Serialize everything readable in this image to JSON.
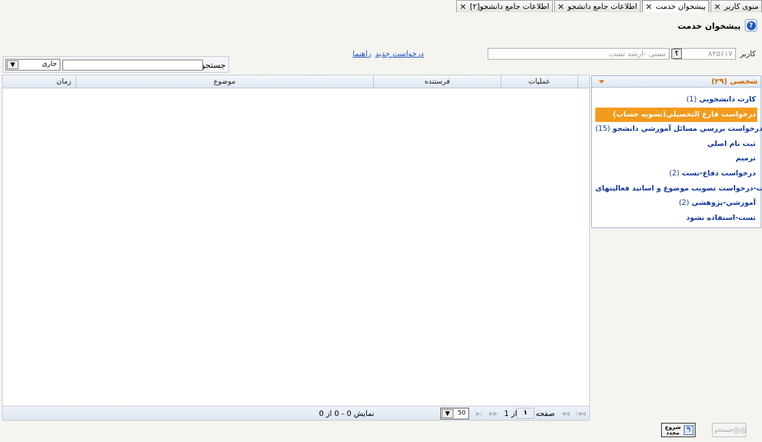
{
  "tabs": [
    {
      "label": "منوی کاربر",
      "active": false
    },
    {
      "label": "پیشخوان خدمت",
      "active": true
    },
    {
      "label": "اطلاعات جامع دانشجو",
      "active": false
    },
    {
      "label": "اطلاعات جامع دانشجو[۲]",
      "active": false
    }
  ],
  "header": {
    "title": "پیشخوان خدمت",
    "help_icon": "?"
  },
  "user": {
    "label": "کاربر",
    "code": "۸۴۵۶۱۷",
    "lookup": "؟",
    "name": "تستی -ارشد تست"
  },
  "links": {
    "new_request": "درخواست جديد",
    "help": "راهنما"
  },
  "search": {
    "label": "جستجو",
    "status_value": "جاری",
    "arrow": "▼"
  },
  "grid": {
    "columns": {
      "time": "زمان",
      "subject": "موضوع",
      "sender": "فرستنده",
      "ops": "عملیات"
    },
    "pager": {
      "page_label": "صفحه",
      "page_value": "۱",
      "of_label": "از 1",
      "page_size": "50",
      "display_text": "نمایش 0 - 0 از 0",
      "first": "|◀◀",
      "prev": "◀◀",
      "next": "▶▶",
      "last": "▶|"
    }
  },
  "categories": {
    "title": "شخصی (۲۹)",
    "items": [
      {
        "label": "کارت دانشجويي",
        "count": "(1)",
        "selected": false
      },
      {
        "label": "درخواست فارغ التحصيلي(تسويه حساب)",
        "count": "",
        "selected": true
      },
      {
        "label": "درخواست بررسي مسائل آموزشي دانشجو",
        "count": "(15)",
        "selected": false
      },
      {
        "label": "ثبت نام اصلي",
        "count": "",
        "selected": false
      },
      {
        "label": "ترميم",
        "count": "",
        "selected": false
      },
      {
        "label": "درخواست دفاع-تست",
        "count": "(2)",
        "selected": false
      },
      {
        "label": "تست-درخواست تصويب موضوع و اساتيد فعاليتهای",
        "count": "",
        "selected": false
      },
      {
        "label": "آموزشي-پژوهشي",
        "count": "(2)",
        "selected": false
      },
      {
        "label": "تست-استفاده نشود",
        "count": "",
        "selected": false
      }
    ]
  },
  "buttons": {
    "restart": "شروع مجدد",
    "search": "جستجو"
  }
}
